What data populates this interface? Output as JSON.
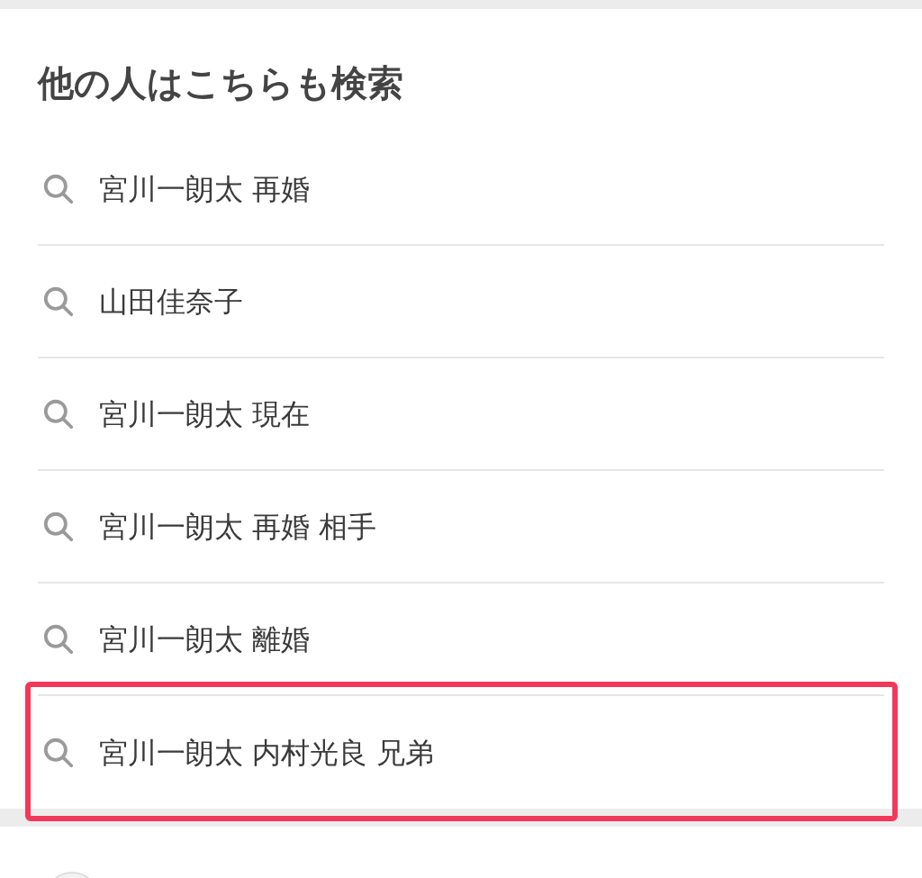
{
  "heading": "他の人はこちらも検索",
  "items": [
    {
      "label": "宮川一朗太 再婚",
      "highlighted": false
    },
    {
      "label": "山田佳奈子",
      "highlighted": false
    },
    {
      "label": "宮川一朗太 現在",
      "highlighted": false
    },
    {
      "label": "宮川一朗太 再婚 相手",
      "highlighted": false
    },
    {
      "label": "宮川一朗太 離婚",
      "highlighted": false
    },
    {
      "label": "宮川一朗太 内村光良 兄弟",
      "highlighted": true
    }
  ]
}
